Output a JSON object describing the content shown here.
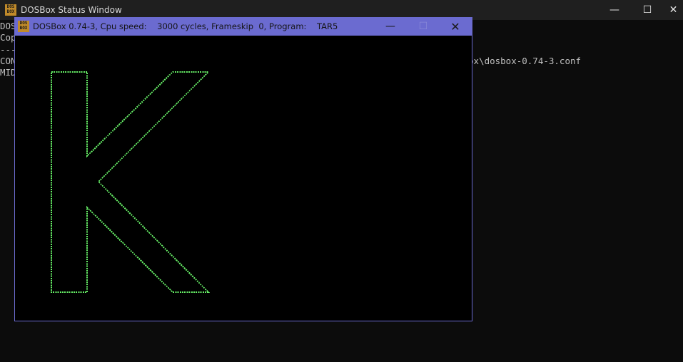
{
  "status_window": {
    "title": "DOSBox Status Window",
    "icon": {
      "top": "DOS",
      "bottom": "BOX"
    },
    "controls": {
      "minimize": "—",
      "maximize": "☐",
      "close": "✕"
    },
    "console_lines": [
      "DOS",
      "Cop",
      "---",
      "CON",
      "MID"
    ],
    "console_right": "ox\\dosbox-0.74-3.conf"
  },
  "dosbox_window": {
    "title": "DOSBox 0.74-3, Cpu speed:    3000 cycles, Frameskip  0, Program:    TAR5",
    "icon": {
      "top": "DOS",
      "bottom": "BOX"
    },
    "controls": {
      "minimize": "—",
      "maximize": "☐",
      "close": "✕"
    },
    "graphics": {
      "letter": "K",
      "stroke_color": "#66ee66",
      "background": "#000000"
    }
  }
}
